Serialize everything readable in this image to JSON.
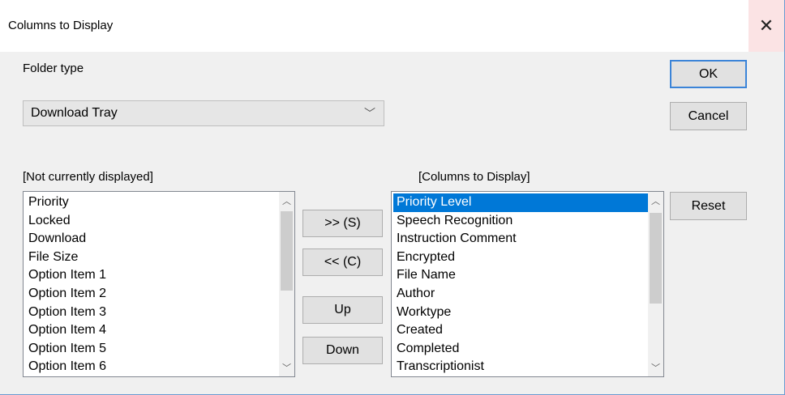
{
  "window": {
    "title": "Columns to Display"
  },
  "folder_type": {
    "label": "Folder type",
    "selected": "Download Tray"
  },
  "buttons": {
    "ok": "OK",
    "cancel": "Cancel",
    "reset": "Reset",
    "add": ">> (S)",
    "remove": "<< (C)",
    "up": "Up",
    "down": "Down"
  },
  "not_displayed": {
    "label": "[Not currently displayed]",
    "items": [
      "Priority",
      "Locked",
      "Download",
      "File Size",
      "Option Item 1",
      "Option Item 2",
      "Option Item 3",
      "Option Item 4",
      "Option Item 5",
      "Option Item 6"
    ]
  },
  "displayed": {
    "label": "[Columns to Display]",
    "selected_item": "Priority Level",
    "items": [
      "Priority Level",
      "Speech Recognition",
      "Instruction Comment",
      "Encrypted",
      "File Name",
      "Author",
      "Worktype",
      "Created",
      "Completed",
      "Transcriptionist"
    ]
  },
  "icons": {
    "close": "close-icon",
    "dropdown": "chevron-down-icon",
    "scroll_up": "scroll-up-arrow-icon",
    "scroll_down": "scroll-down-arrow-icon"
  },
  "colors": {
    "selection": "#0078d7",
    "close_hover": "#fbe3e4",
    "default_border": "#3b84d8"
  }
}
